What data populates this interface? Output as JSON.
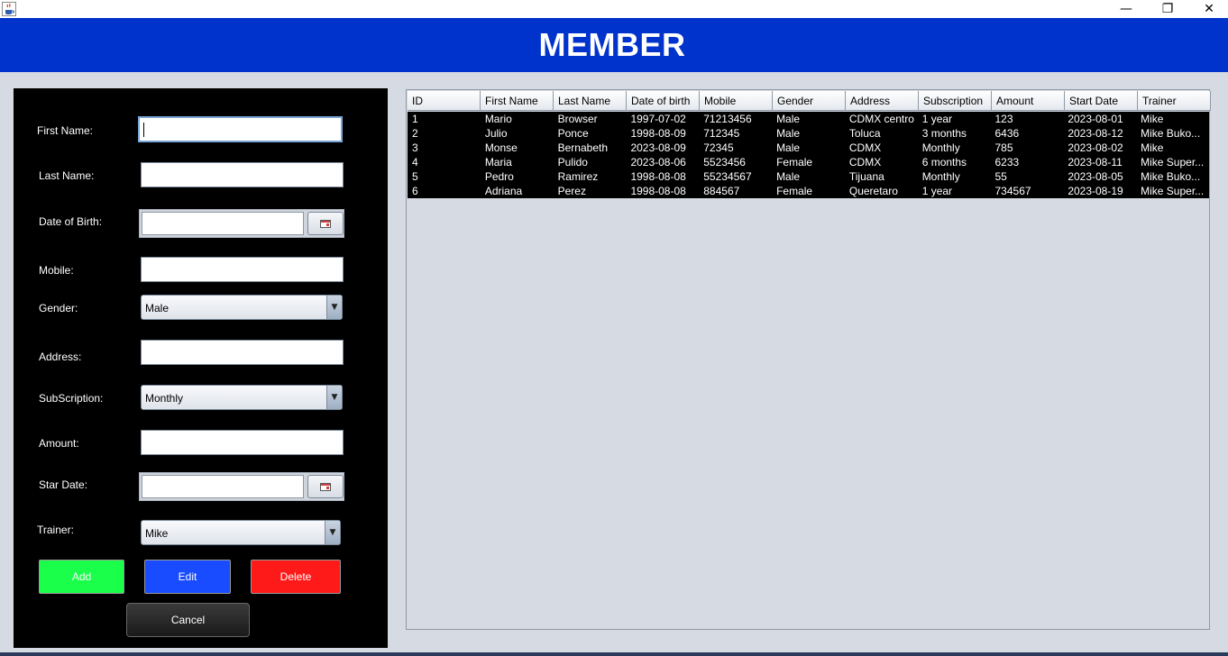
{
  "window": {
    "icon": "java-cup-icon",
    "minimize_glyph": "—",
    "maximize_glyph": "❐",
    "close_glyph": "✕"
  },
  "header": {
    "title": "MEMBER",
    "background": "#0033cc"
  },
  "form": {
    "first_name": {
      "label": "First Name:",
      "value": ""
    },
    "last_name": {
      "label": "Last Name:",
      "value": ""
    },
    "date_of_birth": {
      "label": "Date of Birth:",
      "value": ""
    },
    "mobile": {
      "label": "Mobile:",
      "value": ""
    },
    "gender": {
      "label": "Gender:",
      "value": "Male"
    },
    "address": {
      "label": "Address:",
      "value": ""
    },
    "subscription": {
      "label": "SubScription:",
      "value": "Monthly"
    },
    "amount": {
      "label": "Amount:",
      "value": ""
    },
    "start_date": {
      "label": "Star Date:",
      "value": ""
    },
    "trainer": {
      "label": "Trainer:",
      "value": "Mike"
    },
    "buttons": {
      "add": "Add",
      "edit": "Edit",
      "delete": "Delete",
      "cancel": "Cancel"
    },
    "colors": {
      "add": "#1aff4a",
      "edit": "#1a4cff",
      "delete": "#ff1a1a"
    }
  },
  "table": {
    "columns": [
      "ID",
      "First Name",
      "Last Name",
      "Date of birth",
      "Mobile",
      "Gender",
      "Address",
      "Subscription",
      "Amount",
      "Start Date",
      "Trainer"
    ],
    "rows": [
      [
        "1",
        "Mario",
        "Browser",
        "1997-07-02",
        "71213456",
        "Male",
        "CDMX centro",
        "1 year",
        "123",
        "2023-08-01",
        "Mike"
      ],
      [
        "2",
        "Julio",
        "Ponce",
        "1998-08-09",
        "712345",
        "Male",
        "Toluca",
        "3 months",
        "6436",
        "2023-08-12",
        "Mike Buko..."
      ],
      [
        "3",
        "Monse",
        "Bernabeth",
        "2023-08-09",
        "72345",
        "Male",
        "CDMX",
        "Monthly",
        "785",
        "2023-08-02",
        "Mike"
      ],
      [
        "4",
        "Maria",
        "Pulido",
        "2023-08-06",
        "5523456",
        "Female",
        "CDMX",
        "6 months",
        "6233",
        "2023-08-11",
        "Mike Super..."
      ],
      [
        "5",
        "Pedro",
        "Ramirez",
        "1998-08-08",
        "55234567",
        "Male",
        "Tijuana",
        "Monthly",
        "55",
        "2023-08-05",
        "Mike Buko..."
      ],
      [
        "6",
        "Adriana",
        "Perez",
        "1998-08-08",
        "884567",
        "Female",
        "Queretaro",
        "1 year",
        "734567",
        "2023-08-19",
        "Mike Super..."
      ]
    ]
  }
}
